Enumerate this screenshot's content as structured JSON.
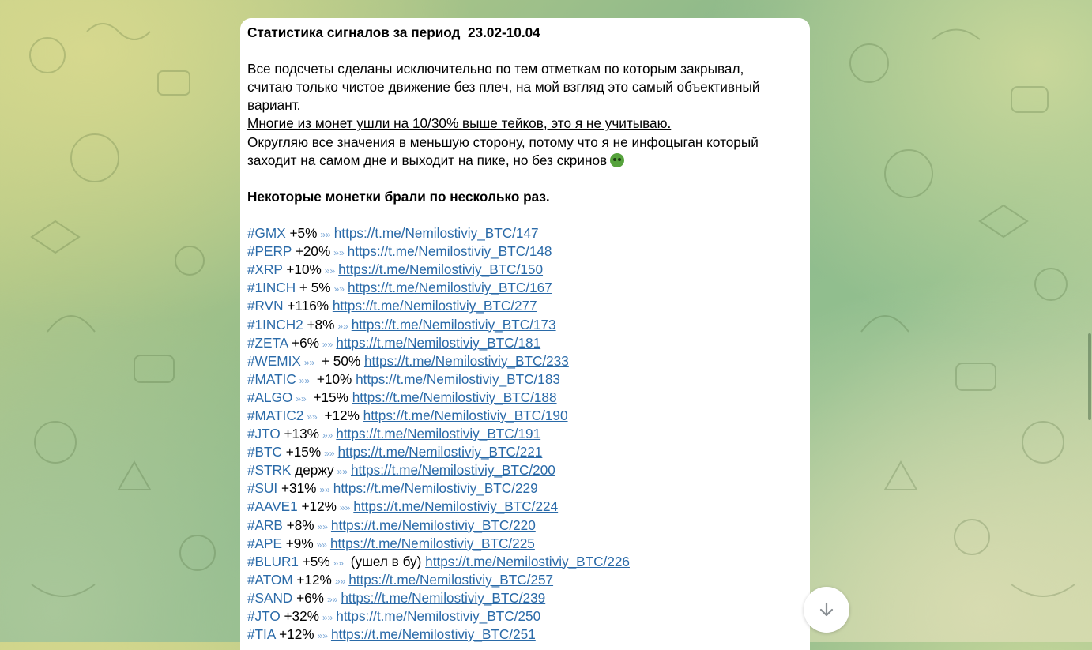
{
  "message": {
    "title": "Статистика сигналов за период  23.02-10.04",
    "intro_lines": [
      "Все подсчеты сделаны исключительно по тем отметкам по которым закрывал,",
      "считаю только чистое движение без плеч, на мой взгляд это самый объективный",
      "вариант."
    ],
    "underlined_line": "Многие из монет ушли на 10/30% выше тейков, это я не учитываю.",
    "rounding_lines": [
      "Округляю все значения в меньшую сторону, потому что я не инфоцыган который",
      "заходит на самом дне и выходит на пике, но без скринов"
    ],
    "emoji_icon": "smiling-devil-emoji",
    "bold_note": "Некоторые монетки брали по несколько раз.",
    "signals": [
      {
        "tag": "#GMX",
        "pre": " +5%",
        "post": "",
        "link": "https://t.me/Nemilostiviy_BTC/147"
      },
      {
        "tag": "#PERP",
        "pre": " +20%",
        "post": "",
        "link": "https://t.me/Nemilostiviy_BTC/148"
      },
      {
        "tag": "#XRP",
        "pre": " +10%",
        "post": "",
        "link": "https://t.me/Nemilostiviy_BTC/150"
      },
      {
        "tag": "#1INCH",
        "pre": " + 5%",
        "post": "",
        "link": "https://t.me/Nemilostiviy_BTC/167"
      },
      {
        "tag": "#RVN",
        "pre": " +116%",
        "post": "",
        "link": "https://t.me/Nemilostiviy_BTC/277",
        "no_arrow": true
      },
      {
        "tag": "#1INCH2",
        "pre": " +8%",
        "post": "",
        "link": "https://t.me/Nemilostiviy_BTC/173"
      },
      {
        "tag": "#ZETA",
        "pre": " +6%",
        "post": "",
        "link": "https://t.me/Nemilostiviy_BTC/181"
      },
      {
        "tag": "#WEMIX",
        "pre": "",
        "post": " + 50%",
        "link": "https://t.me/Nemilostiviy_BTC/233"
      },
      {
        "tag": "#MATIC",
        "pre": "",
        "post": " +10%",
        "link": "https://t.me/Nemilostiviy_BTC/183"
      },
      {
        "tag": "#ALGO",
        "pre": "",
        "post": " +15%",
        "link": "https://t.me/Nemilostiviy_BTC/188"
      },
      {
        "tag": "#MATIC2",
        "pre": "",
        "post": " +12%",
        "link": "https://t.me/Nemilostiviy_BTC/190"
      },
      {
        "tag": "#JTO",
        "pre": " +13%",
        "post": "",
        "link": "https://t.me/Nemilostiviy_BTC/191"
      },
      {
        "tag": "#BTC",
        "pre": " +15%",
        "post": "",
        "link": "https://t.me/Nemilostiviy_BTC/221"
      },
      {
        "tag": "#STRK",
        "pre": " держу",
        "post": "",
        "link": "https://t.me/Nemilostiviy_BTC/200"
      },
      {
        "tag": "#SUI",
        "pre": " +31%",
        "post": "",
        "link": "https://t.me/Nemilostiviy_BTC/229"
      },
      {
        "tag": "#AAVE1",
        "pre": " +12%",
        "post": "",
        "link": "https://t.me/Nemilostiviy_BTC/224"
      },
      {
        "tag": "#ARB",
        "pre": " +8%",
        "post": "",
        "link": "https://t.me/Nemilostiviy_BTC/220"
      },
      {
        "tag": "#APE",
        "pre": " +9%",
        "post": "",
        "link": "https://t.me/Nemilostiviy_BTC/225"
      },
      {
        "tag": "#BLUR1",
        "pre": " +5%",
        "post": " (ушел в бу)",
        "link": "https://t.me/Nemilostiviy_BTC/226"
      },
      {
        "tag": "#ATOM",
        "pre": " +12%",
        "post": "",
        "link": "https://t.me/Nemilostiviy_BTC/257"
      },
      {
        "tag": "#SAND",
        "pre": " +6%",
        "post": "",
        "link": "https://t.me/Nemilostiviy_BTC/239"
      },
      {
        "tag": "#JTO",
        "pre": " +32%",
        "post": "",
        "link": "https://t.me/Nemilostiviy_BTC/250"
      },
      {
        "tag": "#TIA",
        "pre": " +12%",
        "post": "",
        "link": "https://t.me/Nemilostiviy_BTC/251"
      }
    ]
  },
  "controls": {
    "scroll_down_icon": "arrow-down-icon"
  },
  "colors": {
    "link": "#2a6aa8",
    "bubble": "#ffffff"
  }
}
